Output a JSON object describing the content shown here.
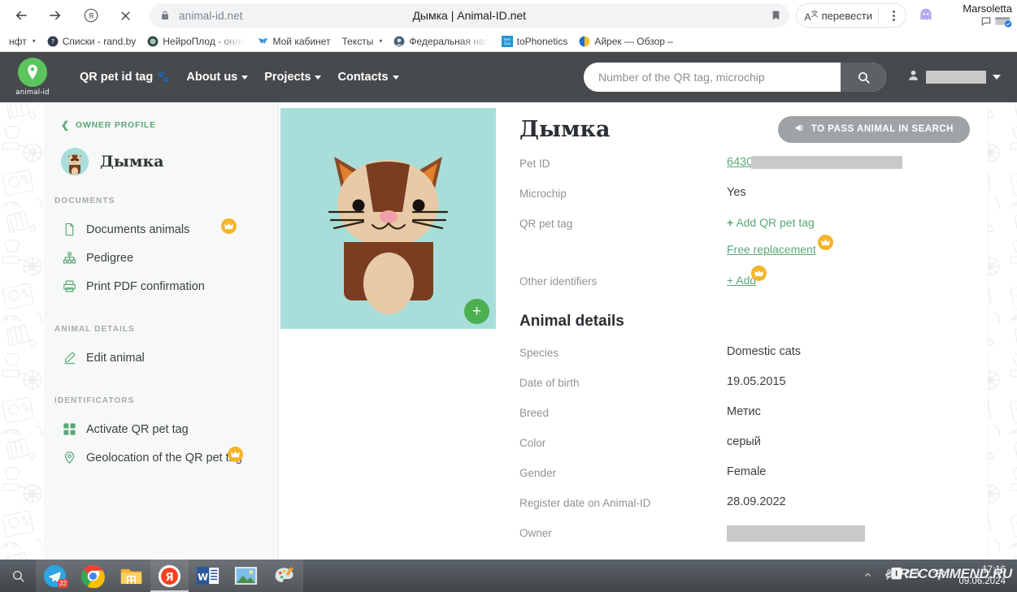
{
  "browser": {
    "back_icon": "arrow-left-icon",
    "forward_icon": "arrow-right-icon",
    "reload_icon": "yandex-reload-icon",
    "stop_icon": "close-icon",
    "lock_icon": "lock-icon",
    "url": "animal-id.net",
    "tab_title": "Дымка | Animal-ID.net",
    "bookmark_icon": "bookmark-icon",
    "translate_label": "перевести",
    "translate_glyph": "A",
    "menu_icon": "kebab-menu-icon",
    "extension_icon": "ghost-extension-icon",
    "profile_name": "Marsoletta",
    "bookmarks": [
      {
        "label": "нфт",
        "icon": "none",
        "caret": true
      },
      {
        "label": "Списки - rand.by",
        "icon": "question-circle-icon",
        "caret": false
      },
      {
        "label": "НейроПлод - онла",
        "icon": "dark-circle-icon",
        "caret": false,
        "truncated": true
      },
      {
        "label": "Мой кабинет",
        "icon": "bird-icon",
        "caret": false
      },
      {
        "label": "Тексты",
        "icon": "none",
        "caret": true
      },
      {
        "label": "Федеральная нал",
        "icon": "emblem-icon",
        "caret": false,
        "truncated": true
      },
      {
        "label": "toPhonetics",
        "icon": "tophonetics-icon",
        "caret": false
      },
      {
        "label": "Айрек — Обзор –",
        "icon": "pie-circle-icon",
        "caret": false
      }
    ]
  },
  "site_header": {
    "logo_text": "animal-id",
    "logo_icon": "animal-id-paw-pin-logo",
    "nav": [
      {
        "label": "QR pet id tag",
        "emoji": "🐾",
        "caret": false
      },
      {
        "label": "About us",
        "caret": true
      },
      {
        "label": "Projects",
        "caret": true
      },
      {
        "label": "Contacts",
        "caret": true
      }
    ],
    "search_placeholder": "Number of the QR tag, microchip",
    "search_value": "",
    "search_icon": "search-icon",
    "account_icon": "user-icon",
    "account_name_redacted": true,
    "account_caret_icon": "caret-down-icon"
  },
  "sidebar": {
    "owner_profile_label": "OWNER PROFILE",
    "back_icon": "chevron-left-icon",
    "pet_name": "Дымка",
    "pet_avatar_icon": "cat-avatar",
    "groups": [
      {
        "title": "DOCUMENTS",
        "items": [
          {
            "label": "Documents animals",
            "icon": "document-icon",
            "premium": true
          },
          {
            "label": "Pedigree",
            "icon": "pedigree-tree-icon",
            "premium": false
          },
          {
            "label": "Print PDF confirmation",
            "icon": "printer-icon",
            "premium": false
          }
        ]
      },
      {
        "title": "ANIMAL DETAILS",
        "items": [
          {
            "label": "Edit animal",
            "icon": "pencil-icon",
            "premium": false
          }
        ]
      },
      {
        "title": "IDENTIFICATORS",
        "items": [
          {
            "label": "Activate QR pet tag",
            "icon": "qr-grid-icon",
            "premium": false
          },
          {
            "label": "Geolocation of the QR pet tag",
            "icon": "map-pin-icon",
            "premium": true
          }
        ]
      }
    ]
  },
  "main": {
    "photo_icon": "cat-illustration",
    "photo_add_label": "+",
    "pet_title": "Дымка",
    "pass_button_label": "TO PASS ANIMAL IN SEARCH",
    "pass_button_icon": "megaphone-icon",
    "id_rows": [
      {
        "key": "Pet ID",
        "value": "6430",
        "type": "link-redacted"
      },
      {
        "key": "Microchip",
        "value": "Yes",
        "type": "text"
      },
      {
        "key": "QR pet tag",
        "value": "Add QR pet tag",
        "type": "green-add"
      },
      {
        "key": "",
        "value": "Free replacement",
        "type": "green-link-premium"
      },
      {
        "key": "Other identifiers",
        "value": "+ Add",
        "type": "green-link-premium"
      }
    ],
    "details_title": "Animal details",
    "detail_rows": [
      {
        "key": "Species",
        "value": "Domestic cats"
      },
      {
        "key": "Date of birth",
        "value": "19.05.2015"
      },
      {
        "key": "Breed",
        "value": "Метис"
      },
      {
        "key": "Color",
        "value": "серый"
      },
      {
        "key": "Gender",
        "value": "Female"
      },
      {
        "key": "Register date on Animal-ID",
        "value": "28.09.2022"
      },
      {
        "key": "Owner",
        "value": "",
        "type": "redacted"
      }
    ]
  },
  "taskbar": {
    "search_icon": "search-icon",
    "items": [
      {
        "name": "telegram-icon",
        "badge": "22",
        "state": "open"
      },
      {
        "name": "chrome-icon",
        "badge": "",
        "state": "open"
      },
      {
        "name": "file-explorer-icon",
        "badge": "",
        "state": "open"
      },
      {
        "name": "yandex-browser-icon",
        "badge": "",
        "state": "active"
      },
      {
        "name": "word-icon",
        "badge": "",
        "state": "open"
      },
      {
        "name": "photos-icon",
        "badge": "",
        "state": "open"
      },
      {
        "name": "paint-icon",
        "badge": "",
        "state": "open"
      }
    ],
    "tray": [
      {
        "name": "show-hidden-icons-chevron"
      },
      {
        "name": "microphone-icon"
      },
      {
        "name": "battery-icon"
      },
      {
        "name": "wifi-icon"
      }
    ],
    "time": "17:16",
    "date": "09.06.2024"
  },
  "watermark": {
    "text": "IRECOMMEND.RU"
  },
  "colors": {
    "header_bg": "#474a4d",
    "accent_green": "#5aa777",
    "premium_gold": "#f5b528",
    "photo_bg": "#a8ded9",
    "sidebar_bg": "#f7f9f8",
    "button_gray": "#a0a3a6",
    "link_blue": "#4a7fb5"
  }
}
